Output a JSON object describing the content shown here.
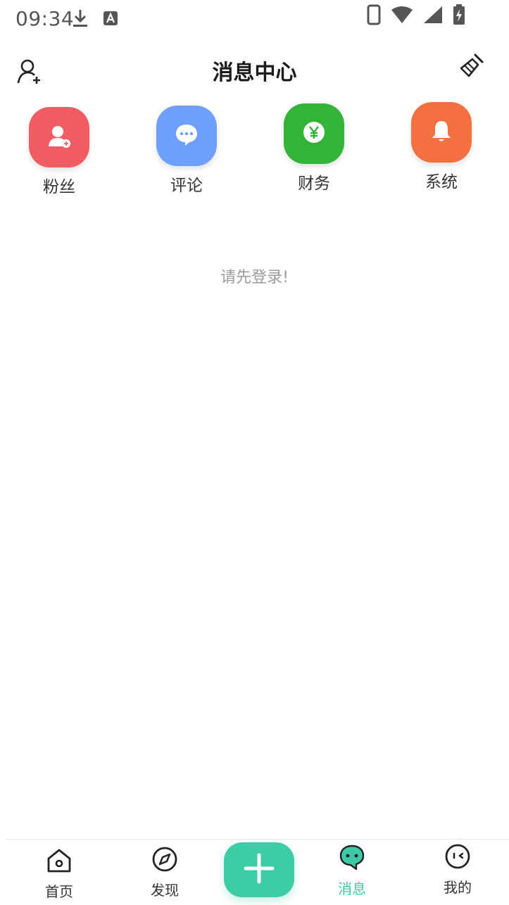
{
  "status_bar": {
    "time": "09:34",
    "left_icons": [
      "download-icon",
      "keyboard-a-icon"
    ],
    "right_icons": [
      "phone-icon",
      "wifi-icon",
      "signal-icon",
      "battery-charging-icon"
    ]
  },
  "header": {
    "title": "消息中心",
    "left_icon": "add-user-icon",
    "right_icon": "broom-icon"
  },
  "categories": [
    {
      "label": "粉丝",
      "icon": "fan-user-icon",
      "color": "#f25d63"
    },
    {
      "label": "评论",
      "icon": "comment-bubble-icon",
      "color": "#6f9ffd"
    },
    {
      "label": "财务",
      "icon": "yuan-coin-icon",
      "color": "#33b338"
    },
    {
      "label": "系统",
      "icon": "bell-icon",
      "color": "#f57041"
    }
  ],
  "empty_state": {
    "text": "请先登录!"
  },
  "tabbar": {
    "active_color": "#3ec9a6",
    "publish_color": "#3ecca7",
    "items": [
      {
        "label": "首页",
        "icon": "home-icon"
      },
      {
        "label": "发现",
        "icon": "compass-icon"
      },
      {
        "label": "消息",
        "icon": "message-icon",
        "active": true
      },
      {
        "label": "我的",
        "icon": "profile-face-icon"
      }
    ],
    "publish_icon": "plus-icon"
  }
}
